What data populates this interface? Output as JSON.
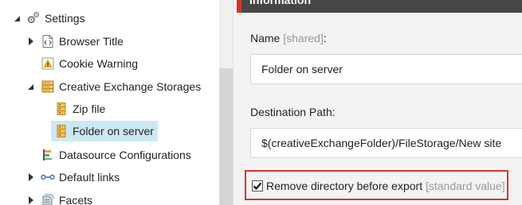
{
  "tree": {
    "items": [
      {
        "label": "Settings",
        "icon": "gear-icon"
      },
      {
        "label": "Browser Title",
        "icon": "code-page-icon"
      },
      {
        "label": "Cookie Warning",
        "icon": "warning-icon"
      },
      {
        "label": "Creative Exchange Storages",
        "icon": "storage-icon"
      },
      {
        "label": "Zip file",
        "icon": "zip-file-icon"
      },
      {
        "label": "Folder on server",
        "icon": "folder-storage-icon"
      },
      {
        "label": "Datasource Configurations",
        "icon": "datasource-icon"
      },
      {
        "label": "Default links",
        "icon": "link-icon"
      },
      {
        "label": "Facets",
        "icon": "facets-icon"
      }
    ]
  },
  "section": {
    "title": "Information"
  },
  "fields": {
    "name": {
      "label": "Name",
      "qualifier": "[shared]",
      "suffix": ":",
      "value": "Folder on server"
    },
    "destination": {
      "label": "Destination Path:",
      "value": "$(creativeExchangeFolder)/FileStorage/New site"
    },
    "remove_directory": {
      "label": "Remove directory before export",
      "qualifier": "[standard value]",
      "checked": true
    }
  },
  "colors": {
    "accent": "#d9342b",
    "header": "#474747",
    "selection": "#cce8f4"
  }
}
